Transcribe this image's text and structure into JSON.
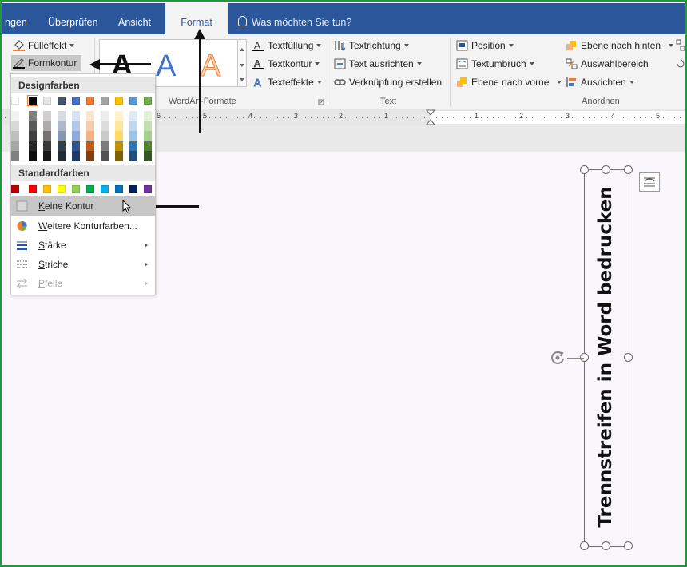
{
  "tabs": {
    "partial": "ngen",
    "review": "Überprüfen",
    "view": "Ansicht",
    "format": "Format",
    "tell_me": "Was möchten Sie tun?"
  },
  "ribbon": {
    "shape_fill": "Fülleffekt",
    "shape_outline": "Formkontur",
    "wordart_letter": "A",
    "wordart_group": "WordArt-Formate",
    "text_fill": "Textfüllung",
    "text_outline": "Textkontur",
    "text_effects": "Texteffekte",
    "text_direction": "Textrichtung",
    "align_text": "Text ausrichten",
    "create_link": "Verknüpfung erstellen",
    "text_group": "Text",
    "position": "Position",
    "wrap_text": "Textumbruch",
    "bring_forward": "Ebene nach vorne",
    "send_backward": "Ebene nach hinten",
    "selection_pane": "Auswahlbereich",
    "align": "Ausrichten",
    "arrange_group": "Anordnen"
  },
  "ruler": {
    "numbers": [
      "6",
      "5",
      "4",
      "3",
      "2",
      "1",
      "1",
      "2",
      "3",
      "4",
      "5"
    ]
  },
  "menu": {
    "theme_colors_heading": "Designfarben",
    "standard_colors_heading": "Standardfarben",
    "no_outline": "Keine Kontur",
    "no_outline_underline": "K",
    "no_outline_rest": "eine Kontur",
    "more_colors_underline": "W",
    "more_colors_rest": "eitere Konturfarben...",
    "weight_underline": "S",
    "weight_rest": "tärke",
    "dashes_underline": "S",
    "dashes_rest": "triche",
    "arrows_underline": "P",
    "arrows_rest": "feile",
    "theme_top": [
      "#ffffff",
      "#000000",
      "#e7e6e6",
      "#44546a",
      "#4472c4",
      "#ed7d31",
      "#a5a5a5",
      "#ffc000",
      "#5b9bd5",
      "#70ad47"
    ],
    "theme_shades": [
      [
        "#f2f2f2",
        "#d9d9d9",
        "#bfbfbf",
        "#a6a6a6",
        "#808080"
      ],
      [
        "#7f7f7f",
        "#595959",
        "#404040",
        "#262626",
        "#0d0d0d"
      ],
      [
        "#d0cece",
        "#aeabab",
        "#757171",
        "#3a3838",
        "#171616"
      ],
      [
        "#d6dce4",
        "#adb9ca",
        "#8496b0",
        "#323f4f",
        "#222a35"
      ],
      [
        "#d9e2f3",
        "#b4c6e7",
        "#8eaadb",
        "#2f5496",
        "#1f3864"
      ],
      [
        "#fbe5d5",
        "#f7cbac",
        "#f4b183",
        "#c55a11",
        "#833c0b"
      ],
      [
        "#ededed",
        "#dbdbdb",
        "#c9c9c9",
        "#7b7b7b",
        "#525252"
      ],
      [
        "#fff2cc",
        "#ffe599",
        "#ffd966",
        "#bf9000",
        "#7f6000"
      ],
      [
        "#deebf6",
        "#bdd7ee",
        "#9dc3e6",
        "#2e75b5",
        "#1f4e79"
      ],
      [
        "#e2efd9",
        "#c5e0b3",
        "#a8d08d",
        "#538135",
        "#375623"
      ]
    ],
    "standard": [
      "#c00000",
      "#ff0000",
      "#ffc000",
      "#ffff00",
      "#92d050",
      "#00b050",
      "#00b0f0",
      "#0070c0",
      "#002060",
      "#7030a0"
    ]
  },
  "textbox": {
    "text": "Trennstreifen in Word bedrucken"
  },
  "colors": {
    "tab_bar": "#2b579a",
    "frame": "#1e9a3b",
    "menu_selected": "#c6c6c6"
  }
}
